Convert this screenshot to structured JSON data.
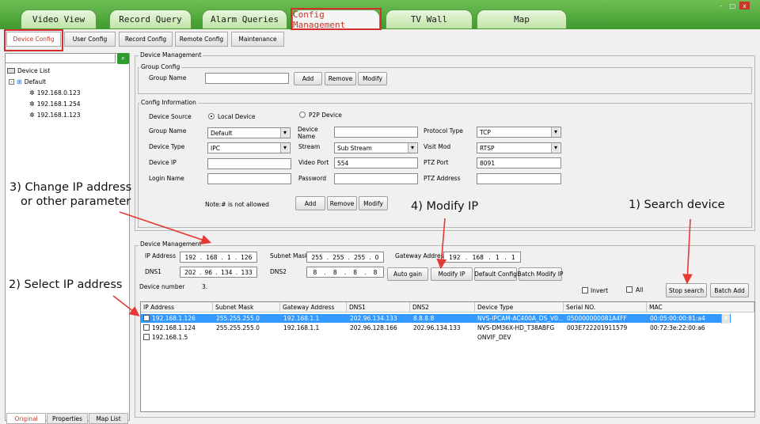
{
  "top_tabs": [
    "Video View",
    "Record Query",
    "Alarm Queries",
    "Config Management",
    "TV Wall",
    "Map"
  ],
  "window_controls": [
    "-",
    "□",
    "x"
  ],
  "sub_tabs": [
    "Device Config",
    "User Config",
    "Record Config",
    "Remote Config",
    "Maintenance"
  ],
  "tree": {
    "root": "Device List",
    "group": "Default",
    "devices": [
      "192.168.0.123",
      "192.168.1.254",
      "192.168.1.123"
    ]
  },
  "bottom_tabs": [
    "Original",
    "Properties",
    "Map List"
  ],
  "device_management_top": {
    "title": "Device Management",
    "group_config": {
      "title": "Group Config",
      "group_name_label": "Group Name",
      "group_name_value": "",
      "buttons": [
        "Add",
        "Remove",
        "Modify"
      ]
    },
    "config_info": {
      "title": "Config Information",
      "device_source_label": "Device Source",
      "local_device": "Local Device",
      "p2p_device": "P2P Device",
      "group_name_label": "Group Name",
      "group_name_value": "Default",
      "device_name_label": "Device Name",
      "device_name_value": "",
      "protocol_type_label": "Protocol Type",
      "protocol_type_value": "TCP",
      "device_type_label": "Device Type",
      "device_type_value": "IPC",
      "stream_label": "Stream",
      "stream_value": "Sub Stream",
      "visit_mod_label": "Visit Mod",
      "visit_mod_value": "RTSP",
      "device_ip_label": "Device IP",
      "device_ip_value": "",
      "video_port_label": "Video Port",
      "video_port_value": "554",
      "ptz_port_label": "PTZ Port",
      "ptz_port_value": "8091",
      "login_name_label": "Login Name",
      "login_name_value": "",
      "password_label": "Password",
      "password_value": "",
      "ptz_address_label": "PTZ Address",
      "ptz_address_value": "",
      "note": "Note:# is not allowed",
      "buttons": [
        "Add",
        "Remove",
        "Modify"
      ]
    }
  },
  "device_management_bottom": {
    "title": "Device Management",
    "ip_address_label": "IP Address",
    "ip_address": [
      "192",
      "168",
      "1",
      "126"
    ],
    "subnet_mask_label": "Subnet Mask",
    "subnet_mask": [
      "255",
      "255",
      "255",
      "0"
    ],
    "gateway_label": "Gateway Addres",
    "gateway": [
      "192",
      "168",
      "1",
      "1"
    ],
    "dns1_label": "DNS1",
    "dns1": [
      "202",
      "96",
      "134",
      "133"
    ],
    "dns2_label": "DNS2",
    "dns2": [
      "8",
      "8",
      "8",
      "8"
    ],
    "buttons": {
      "auto_gain": "Auto gain",
      "modify_ip": "Modify IP",
      "default_config": "Default Config",
      "batch_modify_ip": "Batch Modify IP",
      "stop_search": "Stop search",
      "batch_add": "Batch Add"
    },
    "device_number_label": "Device number",
    "device_number_value": "3.",
    "invert_label": "Invert",
    "all_label": "All"
  },
  "table": {
    "columns": [
      "IP Address",
      "Subnet Mask",
      "Gateway Address",
      "DNS1",
      "DNS2",
      "Device Type",
      "Serial NO.",
      "MAC"
    ],
    "rows": [
      [
        "192.168.1.126",
        "255.255.255.0",
        "192.168.1.1",
        "202.96.134.133",
        "8.8.8.8",
        "NVS-IPCAM-AC400A_DS_V0...",
        "050000000081A4FF",
        "00:05:00:00:81:a4"
      ],
      [
        "192.168.1.124",
        "255.255.255.0",
        "192.168.1.1",
        "202.96.128.166",
        "202.96.134.133",
        "NVS-DM36X-HD_T38ABFG",
        "003E722201911579",
        "00:72:3e:22:00:a6"
      ],
      [
        "192.168.1.5",
        "",
        "",
        "",
        "",
        "ONVIF_DEV",
        "",
        ""
      ]
    ]
  },
  "annotations": {
    "change_ip_line1": "3) Change IP address",
    "change_ip_line2": "or other parameter",
    "modify_ip": "4) Modify IP",
    "search_device": "1) Search device",
    "select_ip": "2) Select IP address"
  },
  "colors": {
    "top_bar": "#4fa83a",
    "highlight_box": "#d32f2f",
    "selected_row": "#3399ff",
    "active_tab_text": "#c0392b"
  }
}
